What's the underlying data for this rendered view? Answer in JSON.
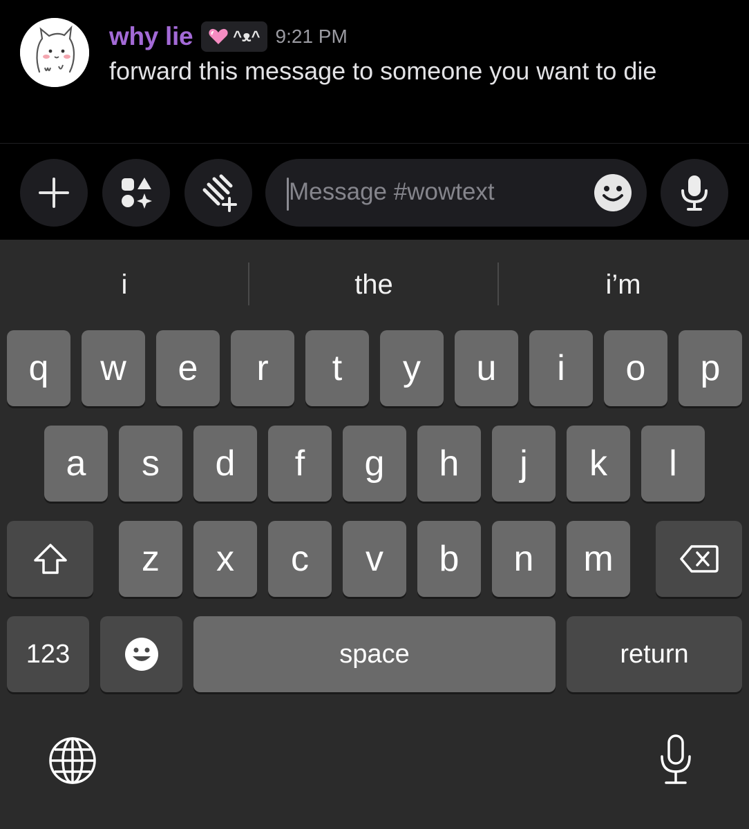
{
  "message": {
    "username": "why lie",
    "tag_text": "^ᴥ^",
    "timestamp": "9:21 PM",
    "body": "forward this message to someone you want to die"
  },
  "composer": {
    "placeholder": "Message #wowtext",
    "buttons": [
      "plus-icon",
      "apps-icon",
      "gift-icon",
      "emoji-icon",
      "microphone-icon"
    ]
  },
  "keyboard": {
    "suggestions": [
      "i",
      "the",
      "i’m"
    ],
    "row1": [
      "q",
      "w",
      "e",
      "r",
      "t",
      "y",
      "u",
      "i",
      "o",
      "p"
    ],
    "row2": [
      "a",
      "s",
      "d",
      "f",
      "g",
      "h",
      "j",
      "k",
      "l"
    ],
    "row3": [
      "z",
      "x",
      "c",
      "v",
      "b",
      "n",
      "m"
    ],
    "numbers_label": "123",
    "space_label": "space",
    "return_label": "return",
    "icons": [
      "shift-icon",
      "delete-icon",
      "emoji-keyboard-icon",
      "globe-icon",
      "dictation-icon"
    ]
  },
  "colors": {
    "background": "#000000",
    "username": "#a36ad6",
    "keyboard_bg": "#2b2b2b",
    "key_bg": "#6a6a6a",
    "key_dark_bg": "#484848"
  }
}
